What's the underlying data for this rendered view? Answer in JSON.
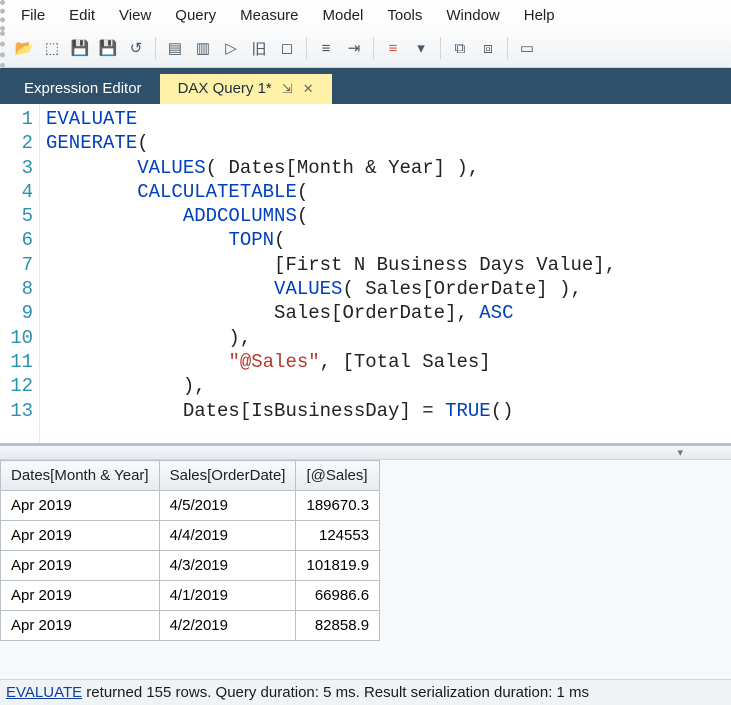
{
  "menu": [
    "File",
    "Edit",
    "View",
    "Query",
    "Measure",
    "Model",
    "Tools",
    "Window",
    "Help"
  ],
  "tabs": {
    "inactive": "Expression Editor",
    "active": "DAX Query 1*"
  },
  "code": {
    "lines": [
      [
        {
          "t": "EVALUATE",
          "c": "kw"
        }
      ],
      [
        {
          "t": "GENERATE",
          "c": "kw"
        },
        {
          "t": "("
        }
      ],
      [
        {
          "t": "        "
        },
        {
          "t": "VALUES",
          "c": "kw"
        },
        {
          "t": "( Dates[Month & Year] ),"
        }
      ],
      [
        {
          "t": "        "
        },
        {
          "t": "CALCULATETABLE",
          "c": "kw"
        },
        {
          "t": "("
        }
      ],
      [
        {
          "t": "            "
        },
        {
          "t": "ADDCOLUMNS",
          "c": "kw"
        },
        {
          "t": "("
        }
      ],
      [
        {
          "t": "                "
        },
        {
          "t": "TOPN",
          "c": "kw"
        },
        {
          "t": "("
        }
      ],
      [
        {
          "t": "                    [First N Business Days Value],"
        }
      ],
      [
        {
          "t": "                    "
        },
        {
          "t": "VALUES",
          "c": "kw"
        },
        {
          "t": "( Sales[OrderDate] ),"
        }
      ],
      [
        {
          "t": "                    Sales[OrderDate], "
        },
        {
          "t": "ASC",
          "c": "kw"
        }
      ],
      [
        {
          "t": "                ),"
        }
      ],
      [
        {
          "t": "                "
        },
        {
          "t": "\"@Sales\"",
          "c": "str"
        },
        {
          "t": ", [Total Sales]"
        }
      ],
      [
        {
          "t": "            ),"
        }
      ],
      [
        {
          "t": "            Dates[IsBusinessDay] = "
        },
        {
          "t": "TRUE",
          "c": "kw"
        },
        {
          "t": "()"
        }
      ]
    ]
  },
  "grid": {
    "headers": [
      "Dates[Month & Year]",
      "Sales[OrderDate]",
      "[@Sales]"
    ],
    "rows": [
      [
        "Apr 2019",
        "4/5/2019",
        "189670.3"
      ],
      [
        "Apr 2019",
        "4/4/2019",
        "124553"
      ],
      [
        "Apr 2019",
        "4/3/2019",
        "101819.9"
      ],
      [
        "Apr 2019",
        "4/1/2019",
        "66986.6"
      ],
      [
        "Apr 2019",
        "4/2/2019",
        "82858.9"
      ]
    ]
  },
  "status": {
    "kw": "EVALUATE",
    "rest": " returned 155 rows. Query duration: 5 ms. Result serialization duration: 1 ms"
  },
  "toolbar_icons": [
    "folder-open-icon",
    "cube-icon",
    "save-icon",
    "save-all-icon",
    "undo-icon",
    "sep",
    "page-icon",
    "page-dual-icon",
    "run-icon",
    "tree-icon",
    "stop-icon",
    "sep",
    "align-left-icon",
    "indent-icon",
    "sep",
    "format-icon",
    "dropdown-icon",
    "sep",
    "collapse-icon",
    "expand-icon",
    "sep",
    "panel-icon"
  ]
}
